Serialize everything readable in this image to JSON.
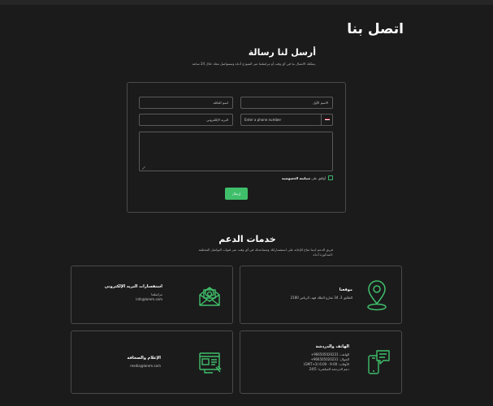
{
  "page": {
    "title": "اتصل بنا"
  },
  "contact_form": {
    "heading": "أرسل لنا رسالة",
    "intro": "يمكنك الاتصال بنا في أي وقت أو مراسلتنا عبر النموذج أدناه وسنتواصل معك خلال 24 ساعة.",
    "first_name_placeholder": "الاسم الأول",
    "last_name_placeholder": "اسم العائلة",
    "phone_placeholder": "Enter a phone number",
    "email_placeholder": "البريد الإلكتروني",
    "message_placeholder": "",
    "consent_prefix": "أوافق على ",
    "consent_link": "سياسة الخصوصية",
    "submit_label": "إرسال",
    "flag_colors": [
      "#c8102e",
      "#ffffff",
      "#111111"
    ]
  },
  "support": {
    "heading": "خدمات الدعم",
    "intro": "فريق الدعم لدينا متاح للإجابة على استفساراتك ومساعدتك في أي وقت عبر قنوات التواصل المختلفة المذكورة أدناه.",
    "cards": {
      "email": {
        "title": "استفسارات البريد الإلكتروني",
        "lines": [
          "مراسلتنا",
          "info@lorem.com"
        ],
        "icon": "envelope-at-icon"
      },
      "location": {
        "title": "موقعنا",
        "lines": [
          "الطابق 3، 34 شارع الملك فهد، الرياض 2180"
        ],
        "icon": "map-pin-icon"
      },
      "media": {
        "title": "الإعلام والصحافة",
        "lines": [
          "media@lorem.com"
        ],
        "icon": "newspaper-icon"
      },
      "phone": {
        "title": "الهاتف والدردشة",
        "lines": [
          "الهاتف: 966505020231+",
          "الجوال: 966505020231+",
          "الأوقات: 9:00 - 6:00 (GMT+3)",
          "دعم الدردشة المباشرة: 24/5"
        ],
        "icon": "phone-chat-icon"
      }
    }
  },
  "accent_color": "#3fbf6a"
}
